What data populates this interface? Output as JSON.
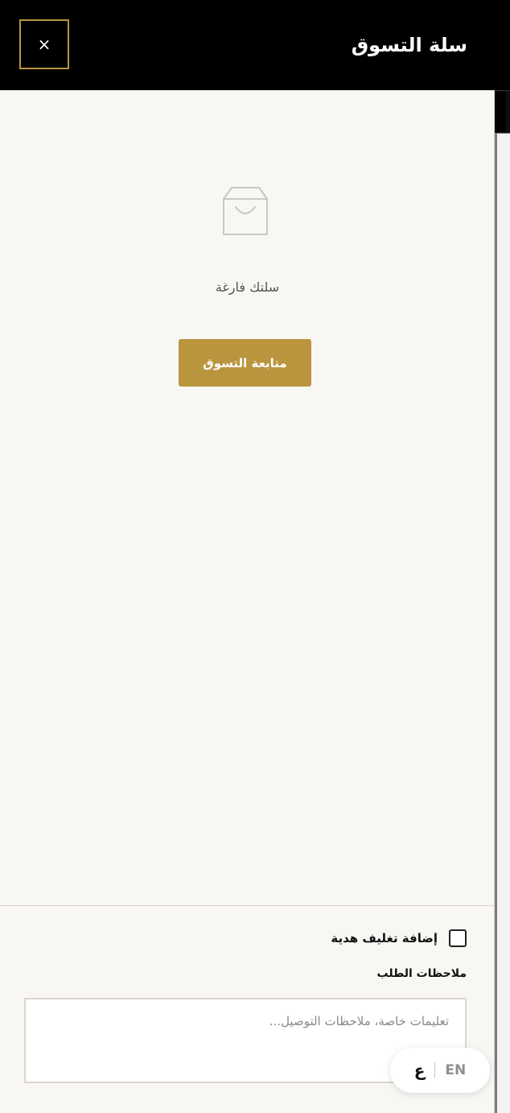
{
  "drawer": {
    "title": "سلة التسوق",
    "close_icon": "×"
  },
  "empty_state": {
    "icon": "shopping-bag-icon",
    "message": "سلتك فارغة",
    "continue_label": "متابعة التسوق"
  },
  "footer": {
    "gift_wrap_label": "إضافة تغليف هدية",
    "gift_wrap_checked": false,
    "notes_label": "ملاحظات الطلب",
    "notes_placeholder": "تعليمات خاصة، ملاحظات التوصيل...",
    "notes_value": ""
  },
  "language_switcher": {
    "arabic": "ع",
    "english": "EN"
  },
  "colors": {
    "accent": "#b9953e",
    "header_bg": "#000000",
    "drawer_bg": "#f8f7f4"
  }
}
